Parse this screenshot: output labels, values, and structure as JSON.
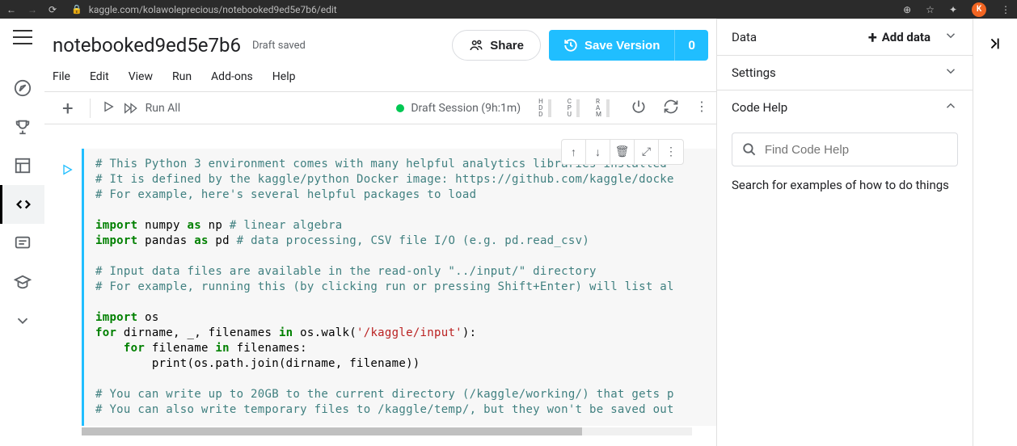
{
  "browser": {
    "url": "kaggle.com/kolawoleprecious/notebooked9ed5e7b6/edit",
    "avatar": "K"
  },
  "header": {
    "notebook_name": "notebooked9ed5e7b6",
    "draft_status": "Draft saved",
    "share": "Share",
    "save_version": "Save Version",
    "save_count": "0"
  },
  "menubar": [
    "File",
    "Edit",
    "View",
    "Run",
    "Add-ons",
    "Help"
  ],
  "toolbar": {
    "run_all": "Run All",
    "session_label": "Draft Session (9h:1m)",
    "metrics": [
      "HDD",
      "CPU",
      "RAM"
    ]
  },
  "cell": {
    "l1": "# This Python 3 environment comes with many helpful analytics libraries installed",
    "l2": "# It is defined by the kaggle/python Docker image: https://github.com/kaggle/docke",
    "l3": "# For example, here's several helpful packages to load",
    "l4_import": "import",
    "l4_name": " numpy ",
    "l4_as": "as",
    "l4_alias": " np ",
    "l4_c": "# linear algebra",
    "l5_import": "import",
    "l5_name": " pandas ",
    "l5_as": "as",
    "l5_alias": " pd ",
    "l5_c": "# data processing, CSV file I/O (e.g. pd.read_csv)",
    "l6": "# Input data files are available in the read-only \"../input/\" directory",
    "l7": "# For example, running this (by clicking run or pressing Shift+Enter) will list al",
    "l8_import": "import",
    "l8_name": " os",
    "l9_for": "for",
    "l9_rest": " dirname, _, filenames ",
    "l9_in": "in",
    "l9_call": " os.walk(",
    "l9_s": "'/kaggle/input'",
    "l9_end": "):",
    "l10_for": "for",
    "l10_rest": " filename ",
    "l10_in": "in",
    "l10_end": " filenames:",
    "l11": "        print(os.path.join(dirname, filename))",
    "l12": "# You can write up to 20GB to the current directory (/kaggle/working/) that gets p",
    "l13": "# You can also write temporary files to /kaggle/temp/, but they won't be saved out"
  },
  "right": {
    "data": "Data",
    "add_data": "Add data",
    "settings": "Settings",
    "code_help": "Code Help",
    "search_placeholder": "Find Code Help",
    "desc": "Search for examples of how to do things"
  }
}
